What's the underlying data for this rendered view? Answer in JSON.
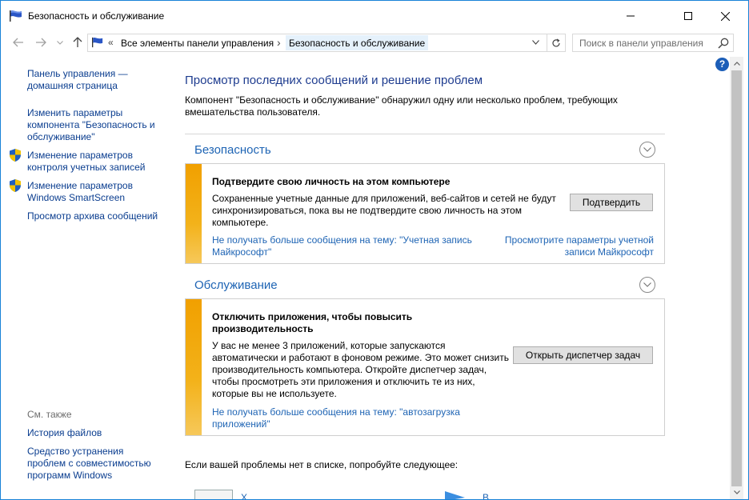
{
  "window": {
    "title": "Безопасность и обслуживание"
  },
  "address": {
    "chevron": "«",
    "crumbs": [
      "Все элементы панели управления",
      "Безопасность и обслуживание"
    ],
    "separator": "›"
  },
  "search": {
    "placeholder": "Поиск в панели управления"
  },
  "help": {
    "label": "?"
  },
  "sidebar": {
    "items": [
      {
        "label": "Панель управления —\nдомашняя страница",
        "shield": false
      },
      {
        "label": "Изменить параметры\nкомпонента \"Безопасность и\nобслуживание\"",
        "shield": false
      },
      {
        "label": "Изменение параметров\nконтроля учетных записей",
        "shield": true
      },
      {
        "label": "Изменение параметров\nWindows SmartScreen",
        "shield": true
      },
      {
        "label": "Просмотр архива сообщений",
        "shield": false
      }
    ],
    "see_also_label": "См. также",
    "see_also": [
      {
        "label": "История файлов"
      },
      {
        "label": "Средство устранения\nпроблем с совместимостью\nпрограмм Windows"
      }
    ]
  },
  "main": {
    "title": "Просмотр последних сообщений и решение проблем",
    "description": "Компонент \"Безопасность и обслуживание\" обнаружил одну или несколько проблем, требующих вмешательства пользователя.",
    "sections": [
      {
        "title": "Безопасность",
        "card": {
          "title": "Подтвердите свою личность на этом компьютере",
          "body": "Сохраненные учетные данные для приложений, веб-сайтов и сетей не будут синхронизироваться, пока вы не подтвердите свою личность на этом компьютере.",
          "button": "Подтвердить",
          "link_left": "Не получать больше сообщения на тему: \"Учетная запись Майкрософт\"",
          "link_right": "Просмотрите параметры учетной записи Майкрософт"
        }
      },
      {
        "title": "Обслуживание",
        "card": {
          "title": "Отключить приложения, чтобы повысить производительность",
          "body": "У вас не менее 3 приложений, которые запускаются автоматически и работают в фоновом режиме. Это может снизить производительность компьютера. Откройте диспетчер задач, чтобы просмотреть эти приложения и отключить те из них, которые вы не используете.",
          "button": "Открыть диспетчер задач",
          "link_left": "Не получать больше сообщения на тему: \"автозагрузка приложений\""
        }
      }
    ],
    "bottom_text": "Если вашей проблемы нет в списке, попробуйте следующее:",
    "bottom_items": [
      {
        "label": "Х"
      },
      {
        "label": "В"
      }
    ]
  },
  "colors": {
    "link": "#1e64b4",
    "heading": "#1e3c8f",
    "warning_bar": "#f1a000",
    "window_border": "#1883d7"
  }
}
